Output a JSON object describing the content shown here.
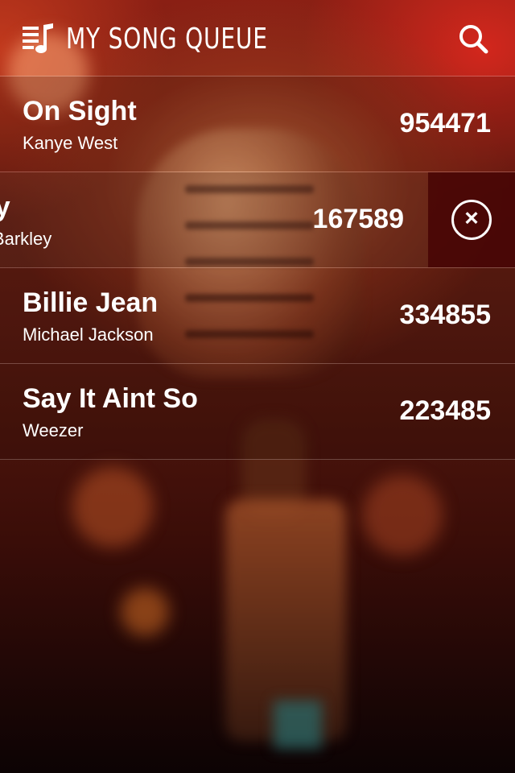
{
  "header": {
    "title": "MY SONG QUEUE",
    "menu_icon": "playlist-music-icon",
    "search_icon": "search-icon"
  },
  "queue": [
    {
      "title": "On Sight",
      "artist": "Kanye West",
      "count": "954471",
      "swiped": false
    },
    {
      "title": "Crazy",
      "artist": "Gnarls Barkley",
      "count": "167589",
      "swiped": true
    },
    {
      "title": "Billie Jean",
      "artist": "Michael Jackson",
      "count": "334855",
      "swiped": false
    },
    {
      "title": "Say It Aint So",
      "artist": "Weezer",
      "count": "223485",
      "swiped": false
    }
  ],
  "delete_icon": "close-circle-icon",
  "colors": {
    "text": "#ffffff",
    "delete_background": "#460404"
  }
}
